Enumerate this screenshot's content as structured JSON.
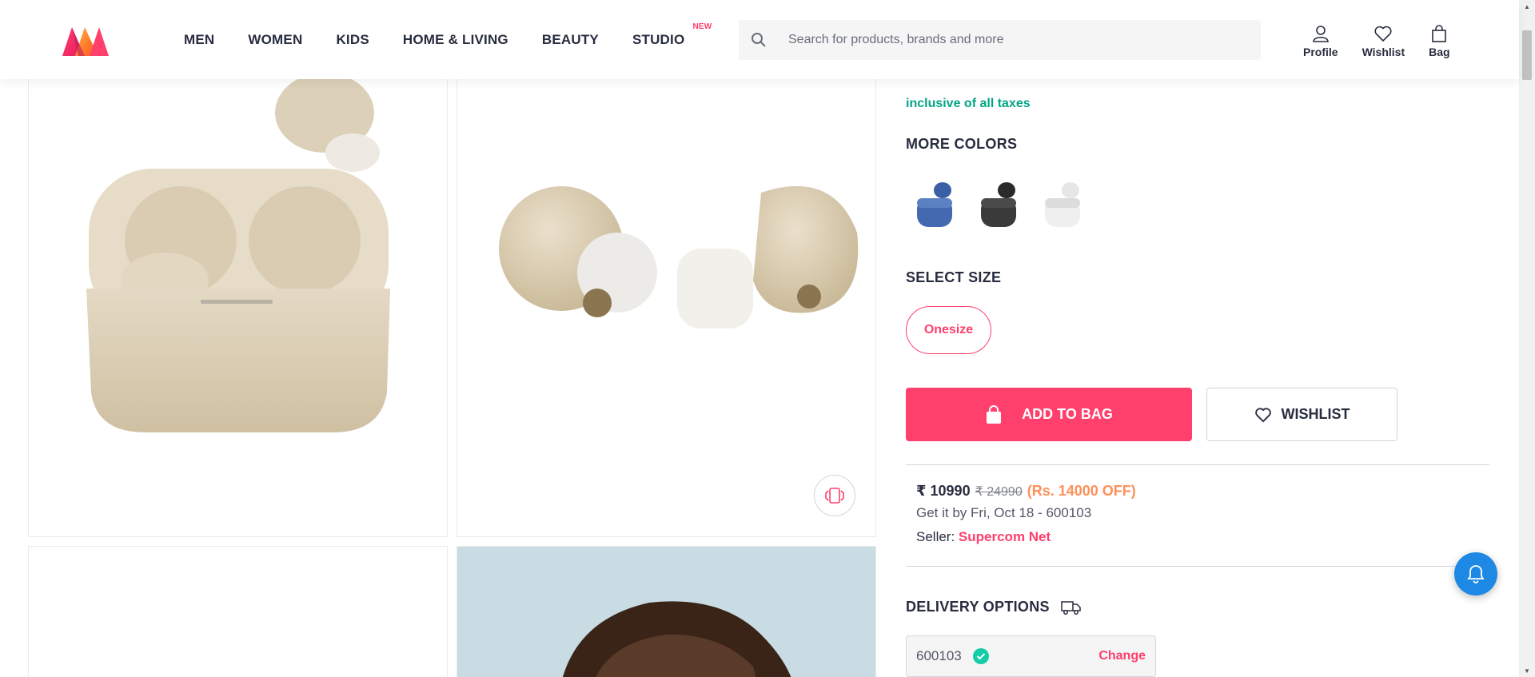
{
  "header": {
    "logo_alt": "Myntra",
    "nav": [
      "MEN",
      "WOMEN",
      "KIDS",
      "HOME & LIVING",
      "BEAUTY",
      "STUDIO"
    ],
    "studio_badge": "NEW",
    "search_placeholder": "Search for products, brands and more",
    "actions": {
      "profile": "Profile",
      "wishlist": "Wishlist",
      "bag": "Bag"
    }
  },
  "product": {
    "taxes_note": "inclusive of all taxes",
    "more_colors_title": "MORE COLORS",
    "color_options": [
      "blue",
      "black",
      "white"
    ],
    "select_size_title": "SELECT SIZE",
    "size": "Onesize",
    "add_to_bag": "ADD TO BAG",
    "wishlist": "WISHLIST",
    "price": "₹ 10990",
    "mrp": "₹ 24990",
    "discount": "(Rs. 14000 OFF)",
    "delivery_date": "Get it by Fri, Oct 18 - 600103",
    "seller_label": "Seller:",
    "seller_name": "Supercom Net",
    "delivery_title": "DELIVERY OPTIONS",
    "pincode": "600103",
    "change": "Change"
  },
  "colors": {
    "accent": "#ff3f6c",
    "green": "#03a685",
    "discount": "#ff905a",
    "bell": "#1e88e5"
  }
}
